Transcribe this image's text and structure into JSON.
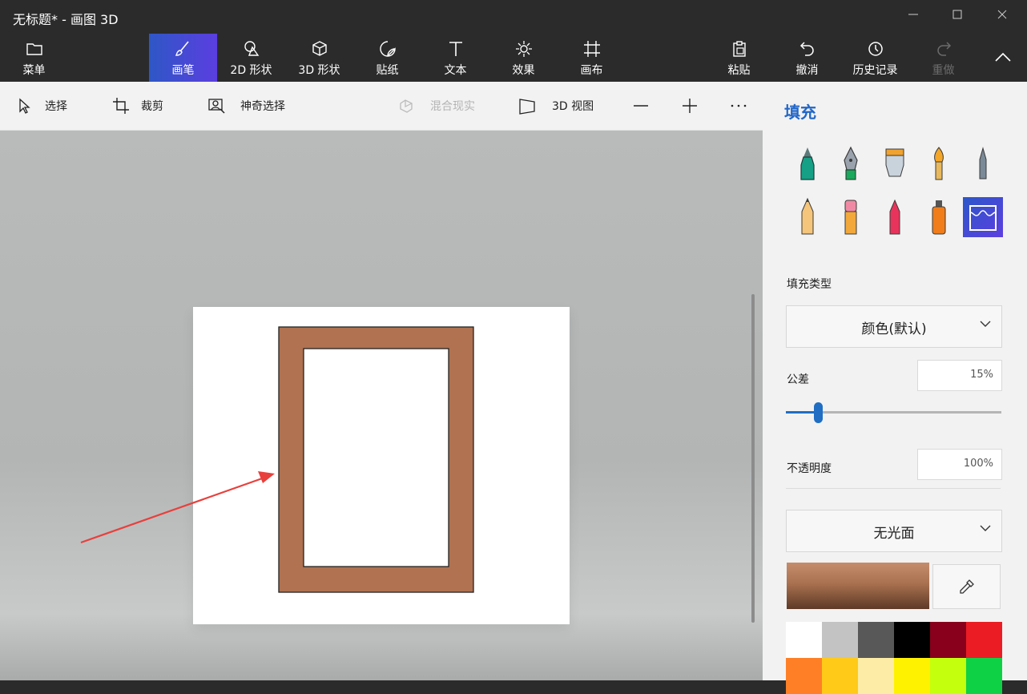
{
  "window": {
    "title": "无标题* - 画图 3D"
  },
  "ribbon": {
    "menu": "菜单",
    "tools": [
      {
        "label": "画笔",
        "icon": "brush-icon",
        "active": true
      },
      {
        "label": "2D 形状",
        "icon": "2d-shapes-icon"
      },
      {
        "label": "3D 形状",
        "icon": "3d-shapes-icon"
      },
      {
        "label": "贴纸",
        "icon": "sticker-icon"
      },
      {
        "label": "文本",
        "icon": "text-icon"
      },
      {
        "label": "效果",
        "icon": "effects-icon"
      },
      {
        "label": "画布",
        "icon": "canvas-icon"
      }
    ],
    "paste": "粘贴",
    "undo": "撤消",
    "history": "历史记录",
    "redo": "重做"
  },
  "toolbar": {
    "select": "选择",
    "crop": "裁剪",
    "magic_select": "神奇选择",
    "mixed_reality": "混合现实",
    "view_3d": "3D 视图"
  },
  "panel": {
    "title": "填充",
    "fill_type_label": "填充类型",
    "fill_type_value": "颜色(默认)",
    "tolerance_label": "公差",
    "tolerance_value": "15%",
    "tolerance_fraction": 0.15,
    "opacity_label": "不透明度",
    "opacity_value": "100%",
    "finish_value": "无光面",
    "current_color": "#a9714f",
    "palette": [
      "#ffffff",
      "#c3c3c3",
      "#585858",
      "#000000",
      "#88001b",
      "#ec1c24",
      "#ff7f27",
      "#ffca18",
      "#fdeca6",
      "#fff200",
      "#c4ff0e",
      "#0ed145"
    ]
  },
  "canvas": {
    "frame_color": "#b07251",
    "arrow_color": "#e8403c"
  }
}
